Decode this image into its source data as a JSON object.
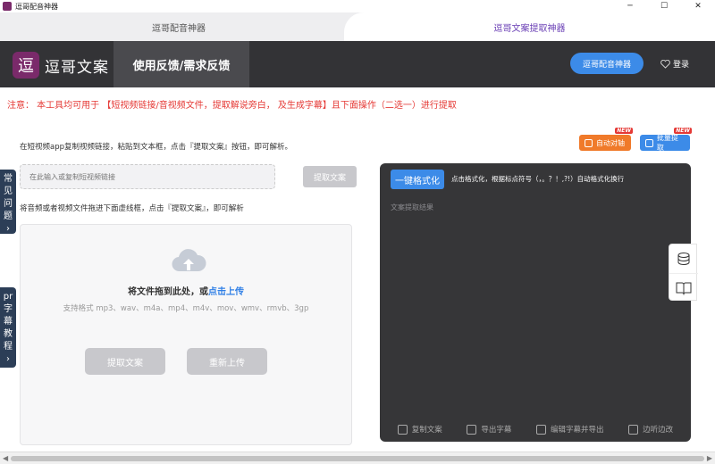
{
  "window": {
    "title": "逗哥配音神器",
    "minimize": "─",
    "maximize": "☐",
    "close": "✕"
  },
  "tabs": [
    {
      "label": "逗哥配音神器"
    },
    {
      "label": "逗哥文案提取神器"
    }
  ],
  "header": {
    "logo_mark": "逗",
    "logo_text": "逗哥文案",
    "feedback": "使用反馈/需求反馈",
    "dub_button": "逗哥配音神器",
    "login": "登录"
  },
  "notice": "注意： 本工具均可用于 【短视频链接/音视频文件，提取解说旁白， 及生成字幕】且下面操作（二选一）进行提取",
  "link_section": {
    "description": "在短视频app复制视频链接，粘贴到文本框，点击『提取文案』按钮，即可解析。",
    "input_placeholder": "在此输入或复制短视频链接",
    "extract_button": "提取文案"
  },
  "file_section": {
    "description": "将音频或者视频文件拖进下面虚线框，点击『提取文案』，即可解析",
    "drop_text": "将文件拖到此处，或",
    "drop_link": "点击上传",
    "formats": "支持格式 mp3、wav、m4a、mp4、m4v、mov、wmv、rmvb、3gp",
    "extract_button": "提取文案",
    "reupload_button": "重新上传"
  },
  "top_buttons": {
    "auto_align": "自动对轴",
    "batch_extract": "批量提取",
    "new_badge": "NEW"
  },
  "result_panel": {
    "format_button": "一键格式化",
    "format_tip": "点击格式化，根据标点符号（，。？！,?!）自动格式化换行",
    "placeholder": "文案提取结果",
    "actions": [
      "复制文案",
      "导出字幕",
      "编辑字幕并导出",
      "边听边改"
    ]
  },
  "side_tabs": {
    "faq": [
      "常",
      "见",
      "问",
      "题",
      "›"
    ],
    "pr": [
      "pr",
      "字",
      "幕",
      "教",
      "程",
      "›"
    ]
  },
  "colors": {
    "header_bg": "#333336",
    "accent_blue": "#3c8be8",
    "notice_red": "#e53935",
    "brand_purple": "#7a2a6a",
    "orange": "#f07a2a"
  }
}
